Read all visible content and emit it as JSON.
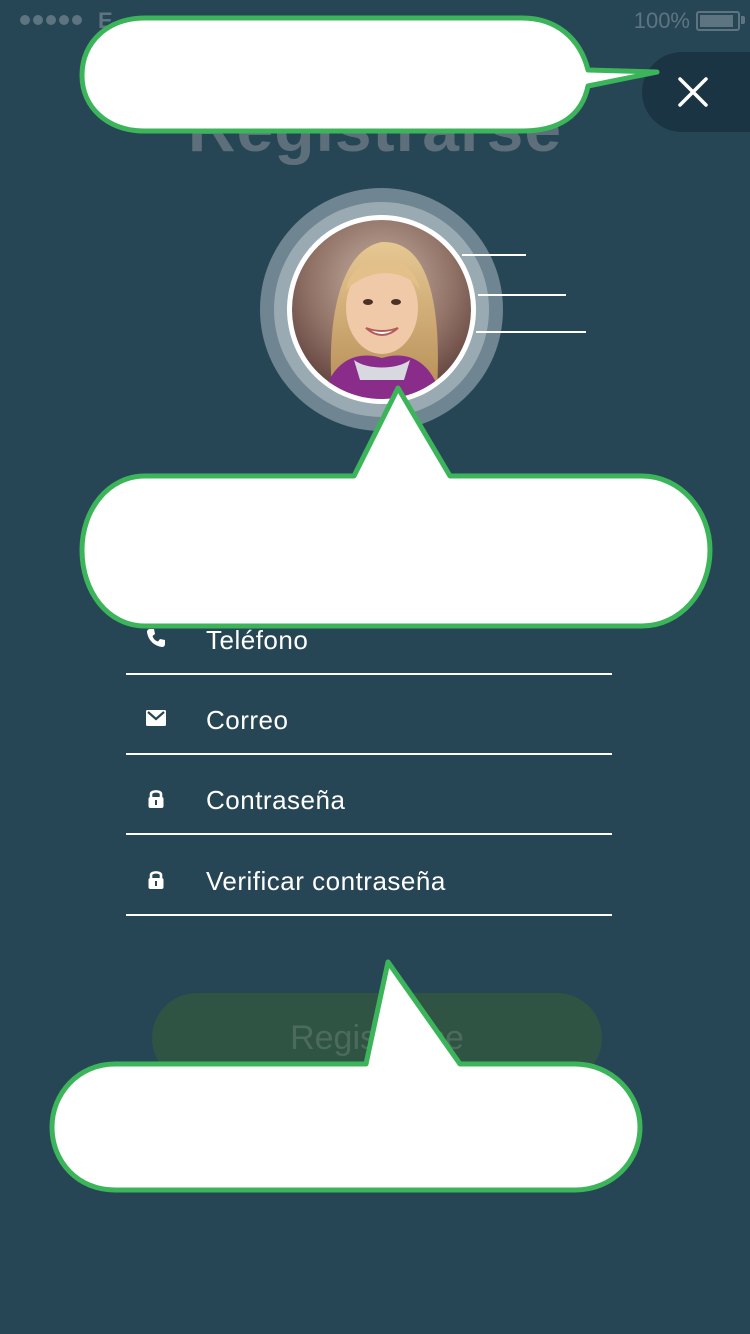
{
  "status_bar": {
    "carrier": "E",
    "battery_percent": "100%"
  },
  "header": {
    "title": "Registrarse"
  },
  "avatar": {
    "photo_icon": "user-photo"
  },
  "form": {
    "fields": [
      {
        "icon": "phone-icon",
        "label": "Teléfono"
      },
      {
        "icon": "mail-icon",
        "label": "Correo"
      },
      {
        "icon": "lock-icon",
        "label": "Contraseña"
      },
      {
        "icon": "lock-icon",
        "label": "Verificar contraseña"
      }
    ]
  },
  "register_button": {
    "label": "Registrarse"
  },
  "colors": {
    "background": "#264656",
    "callout_border": "#3cb55a",
    "callout_fill": "#ffffff",
    "button": "#2f5443"
  }
}
